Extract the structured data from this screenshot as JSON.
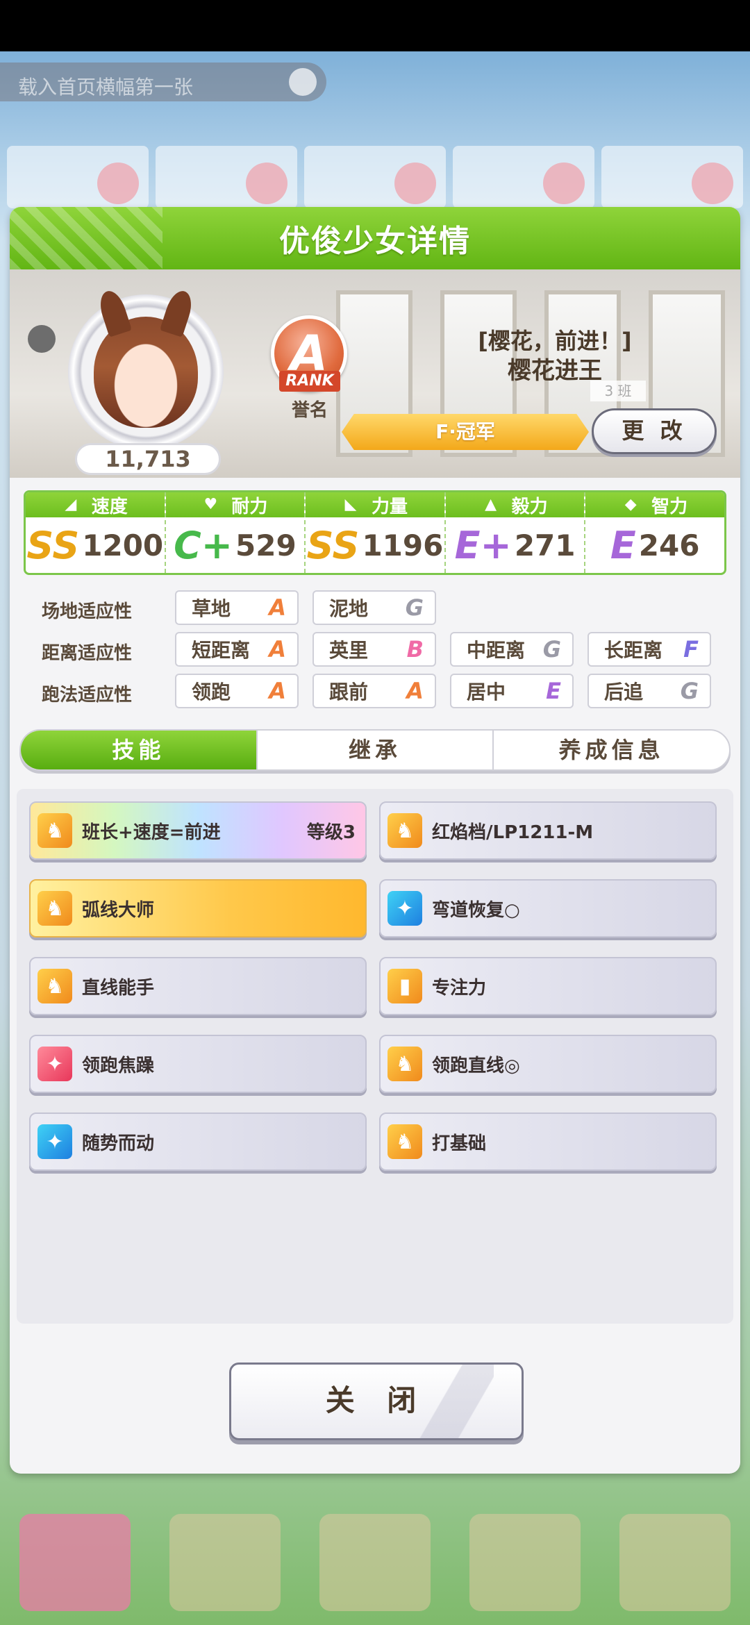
{
  "background": {
    "banner_text": "载入首页横幅第一张"
  },
  "panel": {
    "title": "优俊少女详情"
  },
  "character": {
    "fans": "11,713",
    "rank_letter": "A",
    "rank_word": "RANK",
    "rank_label": "誉名",
    "epithet": "[樱花，前进！]",
    "name": "樱花进王",
    "class_tag": "3 班",
    "title": "F·冠军",
    "change_label": "更 改"
  },
  "stats": [
    {
      "label": "速度",
      "icon": "shoe-icon",
      "grade": "SS",
      "value": "1200"
    },
    {
      "label": "耐力",
      "icon": "heart-icon",
      "grade": "C+",
      "value": "529"
    },
    {
      "label": "力量",
      "icon": "muscle-icon",
      "grade": "SS",
      "value": "1196"
    },
    {
      "label": "毅力",
      "icon": "fire-icon",
      "grade": "E+",
      "value": "271"
    },
    {
      "label": "智力",
      "icon": "graduation-cap-icon",
      "grade": "E",
      "value": "246"
    }
  ],
  "aptitude": {
    "track": {
      "label": "场地适应性",
      "items": [
        {
          "name": "草地",
          "grade": "A"
        },
        {
          "name": "泥地",
          "grade": "G"
        }
      ]
    },
    "distance": {
      "label": "距离适应性",
      "items": [
        {
          "name": "短距离",
          "grade": "A"
        },
        {
          "name": "英里",
          "grade": "B"
        },
        {
          "name": "中距离",
          "grade": "G"
        },
        {
          "name": "长距离",
          "grade": "F"
        }
      ]
    },
    "style": {
      "label": "跑法适应性",
      "items": [
        {
          "name": "领跑",
          "grade": "A"
        },
        {
          "name": "跟前",
          "grade": "A"
        },
        {
          "name": "居中",
          "grade": "E"
        },
        {
          "name": "后追",
          "grade": "G"
        }
      ]
    }
  },
  "tabs": [
    {
      "label": "技能"
    },
    {
      "label": "继承"
    },
    {
      "label": "养成信息"
    }
  ],
  "skills": [
    {
      "name": "班长+速度=前进",
      "level": "等级3",
      "icon": "running-horse-icon"
    },
    {
      "name": "红焰档/LP1211-M",
      "icon": "running-horse-icon"
    },
    {
      "name": "弧线大师",
      "icon": "running-horse-icon"
    },
    {
      "name": "弯道恢复○",
      "icon": "sparkle-icon"
    },
    {
      "name": "直线能手",
      "icon": "running-horse-icon"
    },
    {
      "name": "专注力",
      "icon": "gate-icon"
    },
    {
      "name": "领跑焦躁",
      "icon": "sparkle-icon"
    },
    {
      "name": "领跑直线◎",
      "icon": "running-horse-icon"
    },
    {
      "name": "随势而动",
      "icon": "sparkle-icon"
    },
    {
      "name": "打基础",
      "icon": "running-horse-icon"
    }
  ],
  "close_label": "关 闭",
  "colors": {
    "accent_green": "#6cbe1e",
    "grade_ss": "#e9a415",
    "grade_c": "#47b94b",
    "grade_e": "#a667d9",
    "apt_a": "#f07f3a"
  }
}
